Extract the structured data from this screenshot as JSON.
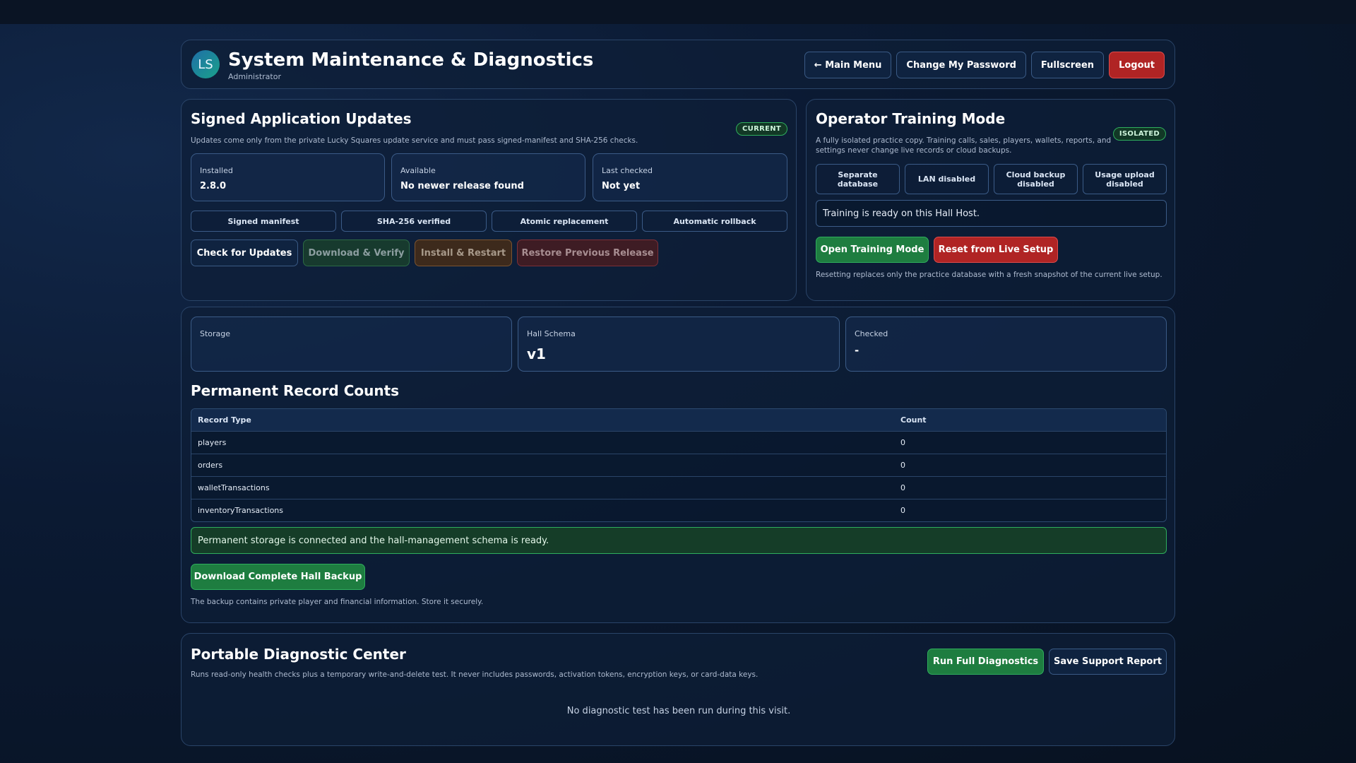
{
  "header": {
    "avatar_initials": "LS",
    "title": "System Maintenance & Diagnostics",
    "subtitle": "Administrator",
    "buttons": {
      "main_menu": "← Main Menu",
      "change_password": "Change My Password",
      "fullscreen": "Fullscreen",
      "logout": "Logout"
    }
  },
  "updates": {
    "title": "Signed Application Updates",
    "badge": "CURRENT",
    "description": "Updates come only from the private Lucky Squares update service and must pass signed-manifest and SHA-256 checks.",
    "stats": [
      {
        "label": "Installed",
        "value": "2.8.0"
      },
      {
        "label": "Available",
        "value": "No newer release found"
      },
      {
        "label": "Last checked",
        "value": "Not yet"
      }
    ],
    "features": [
      "Signed manifest",
      "SHA-256 verified",
      "Atomic replacement",
      "Automatic rollback"
    ],
    "buttons": {
      "check": "Check for Updates",
      "download": "Download & Verify",
      "install": "Install & Restart",
      "restore": "Restore Previous Release"
    }
  },
  "training": {
    "title": "Operator Training Mode",
    "badge": "ISOLATED",
    "description": "A fully isolated practice copy. Training calls, sales, players, wallets, reports, and settings never change live records or cloud backups.",
    "features": [
      "Separate database",
      "LAN disabled",
      "Cloud backup disabled",
      "Usage upload disabled"
    ],
    "status": "Training is ready on this Hall Host.",
    "buttons": {
      "open": "Open Training Mode",
      "reset": "Reset from Live Setup"
    },
    "note": "Resetting replaces only the practice database with a fresh snapshot of the current live setup."
  },
  "storage": {
    "stats": [
      {
        "label": "Storage",
        "value": ""
      },
      {
        "label": "Hall Schema",
        "value": "v1"
      },
      {
        "label": "Checked",
        "value": "-"
      }
    ],
    "counts_title": "Permanent Record Counts",
    "table": {
      "columns": [
        "Record Type",
        "Count"
      ],
      "rows": [
        [
          "players",
          "0"
        ],
        [
          "orders",
          "0"
        ],
        [
          "walletTransactions",
          "0"
        ],
        [
          "inventoryTransactions",
          "0"
        ]
      ]
    },
    "status": "Permanent storage is connected and the hall-management schema is ready.",
    "backup_button": "Download Complete Hall Backup",
    "backup_note": "The backup contains private player and financial information. Store it securely."
  },
  "diagnostics": {
    "title": "Portable Diagnostic Center",
    "description": "Runs read-only health checks plus a temporary write-and-delete test. It never includes passwords, activation tokens, encryption keys, or card-data keys.",
    "buttons": {
      "run": "Run Full Diagnostics",
      "save": "Save Support Report"
    },
    "empty": "No diagnostic test has been run during this visit."
  },
  "colors": {
    "background": "#0b1a33",
    "panel_border": "#2a4468",
    "accent_green": "#1e7d40",
    "accent_red": "#b02424"
  }
}
